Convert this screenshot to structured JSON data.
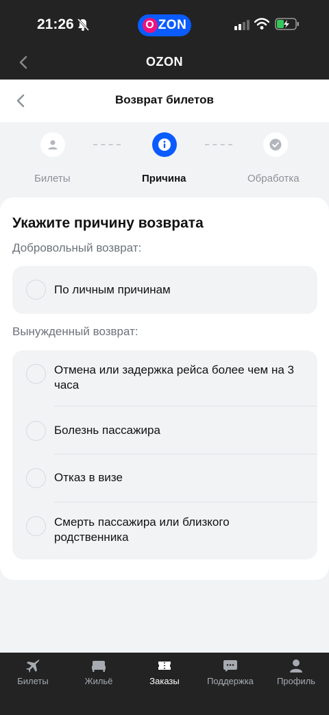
{
  "status_bar": {
    "time": "21:26"
  },
  "top_header": {
    "title": "OZON",
    "brand_logo": "OZON"
  },
  "nav": {
    "title": "Возврат билетов"
  },
  "stepper": {
    "steps": [
      {
        "label": "Билеты",
        "icon": "person-icon",
        "state": "done"
      },
      {
        "label": "Причина",
        "icon": "info-icon",
        "state": "active"
      },
      {
        "label": "Обработка",
        "icon": "check-icon",
        "state": "pending"
      }
    ]
  },
  "card": {
    "title": "Укажите причину возврата",
    "voluntary_label": "Добровольный возврат:",
    "voluntary_options": [
      "По личным причинам"
    ],
    "forced_label": "Вынужденный возврат:",
    "forced_options": [
      "Отмена или задержка рейса более чем на 3 часа",
      "Болезнь пассажира",
      "Отказ в визе",
      "Смерть пассажира или близкого родственника"
    ]
  },
  "tabbar": {
    "tabs": [
      {
        "label": "Билеты",
        "icon": "airplane-icon",
        "active": false
      },
      {
        "label": "Жильё",
        "icon": "bed-icon",
        "active": false
      },
      {
        "label": "Заказы",
        "icon": "ticket-icon",
        "active": true
      },
      {
        "label": "Поддержка",
        "icon": "chat-icon",
        "active": false
      },
      {
        "label": "Профиль",
        "icon": "profile-icon",
        "active": false
      }
    ]
  },
  "colors": {
    "accent": "#0a5cff",
    "brand_pink": "#f1117e",
    "dark_bg": "#232323",
    "page_bg": "#f2f3f5"
  }
}
